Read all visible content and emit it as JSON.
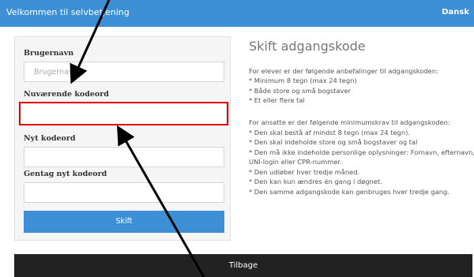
{
  "header": {
    "title": "Velkommen til selvbetjening",
    "language": "Dansk"
  },
  "form": {
    "username_label": "Brugernavn",
    "username_placeholder": "Brugernavn",
    "current_password_label": "Nuværende kodeord",
    "new_password_label": "Nyt kodeord",
    "repeat_password_label": "Gentag nyt kodeord",
    "submit_label": "Skift"
  },
  "info": {
    "heading": "Skift adgangskode",
    "students_intro": "For elever er der følgende anbefalinger til adgangskoden:",
    "students_rules": [
      "* Minimum 8 tegn (max 24 tegn)",
      "* Både store og små bogstaver",
      "* Et eller flere tal"
    ],
    "staff_intro": "For ansatte er der følgende minimumskrav til adgangskoden:",
    "staff_rules": [
      "* Den skal bestå af mindst 8 tegn (max 24 tegn).",
      "* Den skal indeholde store og små bogstaver og tal",
      "* Den må ikke indeholde personlige oplysninger: Fornavn, efternavn,",
      "UNI-login eller CPR-nummer.",
      "* Den udløber hver tredje måned.",
      "* Den kan kun ændres én gang i døgnet.",
      "* Den samme adgangskode kan genbruges hver tredje gang."
    ]
  },
  "footer": {
    "back_label": "Tilbage"
  }
}
